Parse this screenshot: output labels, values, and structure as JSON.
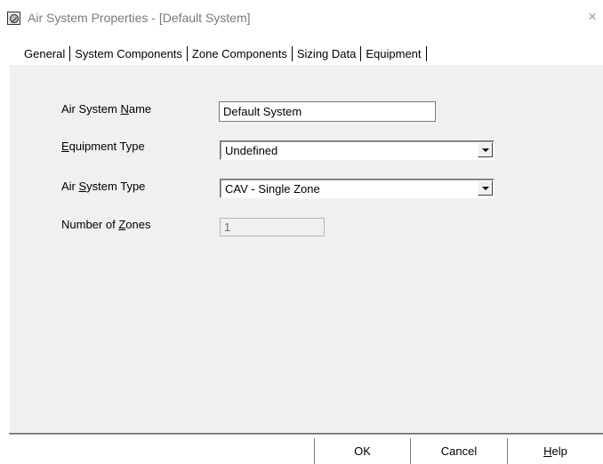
{
  "window": {
    "title": "Air System Properties - [Default System]",
    "close_symbol": "×"
  },
  "tabs": [
    {
      "label": "General",
      "active": true
    },
    {
      "label": "System Components",
      "active": false
    },
    {
      "label": "Zone Components",
      "active": false
    },
    {
      "label": "Sizing Data",
      "active": false
    },
    {
      "label": "Equipment",
      "active": false
    }
  ],
  "form": {
    "name": {
      "label_pre": "Air System ",
      "label_key": "N",
      "label_post": "ame",
      "value": "Default System"
    },
    "equipment_type": {
      "label_pre": "",
      "label_key": "E",
      "label_post": "quipment Type",
      "value": "Undefined"
    },
    "system_type": {
      "label_pre": "Air ",
      "label_key": "S",
      "label_post": "ystem Type",
      "value": "CAV - Single Zone"
    },
    "zones": {
      "label_pre": "Number of ",
      "label_key": "Z",
      "label_post": "ones",
      "value": "1"
    }
  },
  "buttons": {
    "ok": "OK",
    "cancel": "Cancel",
    "help_key": "H",
    "help_rest": "elp"
  },
  "icons": {
    "app": "air-system-icon",
    "close": "close-icon",
    "dropdown": "chevron-down-icon"
  }
}
